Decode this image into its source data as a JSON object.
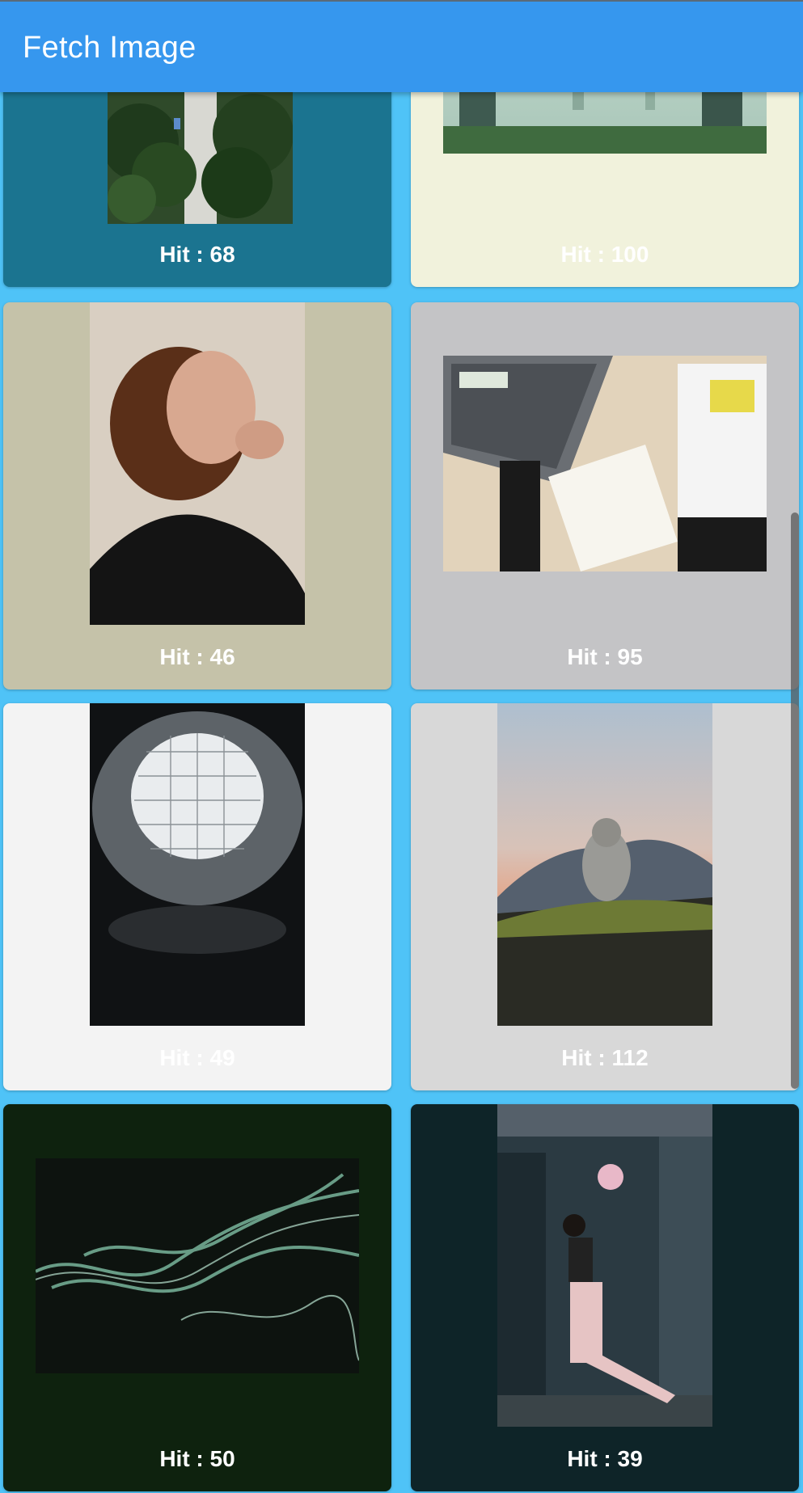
{
  "app": {
    "title": "Fetch Image"
  },
  "cards": [
    {
      "hit": "Hit : 68",
      "background": "#1b7490",
      "label_color": "#ffffff",
      "image": "aerial-forest-road"
    },
    {
      "hit": "Hit : 100",
      "background": "#f1f2dc",
      "label_color": "#ffffff",
      "image": "misty-forest"
    },
    {
      "hit": "Hit : 46",
      "background": "#c5c2a9",
      "label_color": "#ffffff",
      "image": "curly-hair-woman-portrait"
    },
    {
      "hit": "Hit : 95",
      "background": "#c4c4c6",
      "label_color": "#ffffff",
      "image": "laptop-notebook-desk"
    },
    {
      "hit": "Hit : 49",
      "background": "#f3f3f3",
      "label_color": "#ffffff",
      "image": "glass-dome-ceiling"
    },
    {
      "hit": "Hit : 112",
      "background": "#d8d8d8",
      "label_color": "#ffffff",
      "image": "monkey-mountain-sunset"
    },
    {
      "hit": "Hit : 50",
      "background": "#0e220e",
      "label_color": "#ffffff",
      "image": "green-smoke"
    },
    {
      "hit": "Hit : 39",
      "background": "#0e2428",
      "label_color": "#ffffff",
      "image": "woman-market-alley"
    }
  ]
}
